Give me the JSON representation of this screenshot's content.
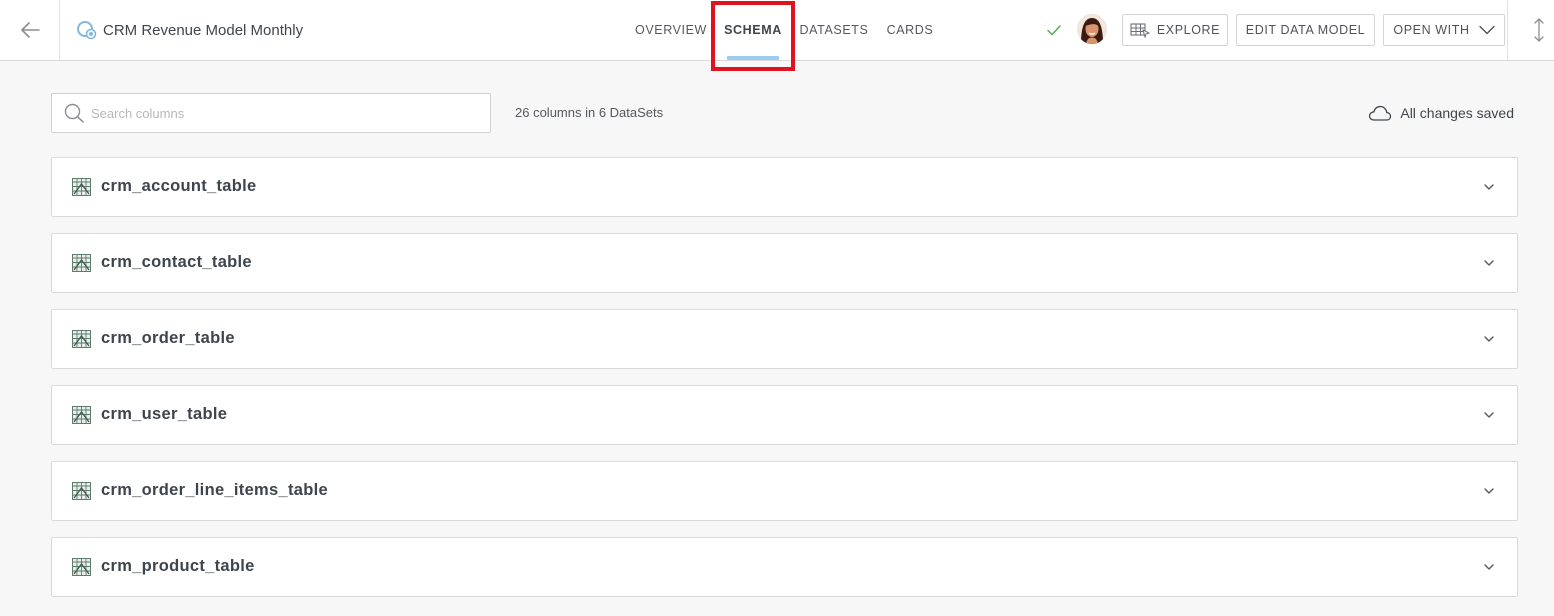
{
  "header": {
    "title": "CRM Revenue Model Monthly",
    "tabs": [
      {
        "label": "OVERVIEW",
        "active": false
      },
      {
        "label": "SCHEMA",
        "active": true
      },
      {
        "label": "DATASETS",
        "active": false
      },
      {
        "label": "CARDS",
        "active": false
      }
    ],
    "buttons": {
      "explore": "EXPLORE",
      "edit_data_model": "EDIT DATA MODEL",
      "open_with": "OPEN WITH"
    },
    "status_color": "#4caf50",
    "accent_color": "#99ccee",
    "highlight_color": "#e0121f"
  },
  "toolbar": {
    "search_placeholder": "Search columns",
    "search_value": "",
    "column_count": "26 columns in 6 DataSets",
    "save_status": "All changes saved"
  },
  "datasets": [
    {
      "name": "crm_account_table"
    },
    {
      "name": "crm_contact_table"
    },
    {
      "name": "crm_order_table"
    },
    {
      "name": "crm_user_table"
    },
    {
      "name": "crm_order_line_items_table"
    },
    {
      "name": "crm_product_table"
    }
  ]
}
